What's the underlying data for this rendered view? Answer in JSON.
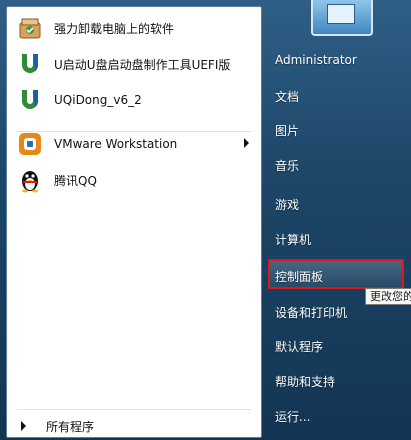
{
  "left_menu": {
    "pinned": [
      {
        "label": "强力卸载电脑上的软件",
        "icon": "uninstall-box-icon"
      },
      {
        "label": "U启动U盘启动盘制作工具UEFI版",
        "icon": "u-logo-icon"
      },
      {
        "label": "UQiDong_v6_2",
        "icon": "u-logo-icon"
      },
      {
        "label": "VMware Workstation",
        "icon": "vmware-icon",
        "has_submenu": true
      },
      {
        "label": "腾讯QQ",
        "icon": "qq-penguin-icon"
      }
    ],
    "all_programs": "所有程序"
  },
  "right_menu": {
    "items": [
      {
        "label": "Administrator"
      },
      {
        "label": "文档"
      },
      {
        "label": "图片"
      },
      {
        "label": "音乐"
      },
      {
        "label": "游戏"
      },
      {
        "label": "计算机"
      },
      {
        "label": "控制面板"
      },
      {
        "label": "设备和打印机"
      },
      {
        "label": "默认程序"
      },
      {
        "label": "帮助和支持"
      },
      {
        "label": "运行..."
      }
    ],
    "tooltip": "更改您的"
  },
  "colors": {
    "highlight_border": "#e0161b",
    "panel_bg": "#ffffff",
    "sidebar_bg": "#1d4668"
  }
}
